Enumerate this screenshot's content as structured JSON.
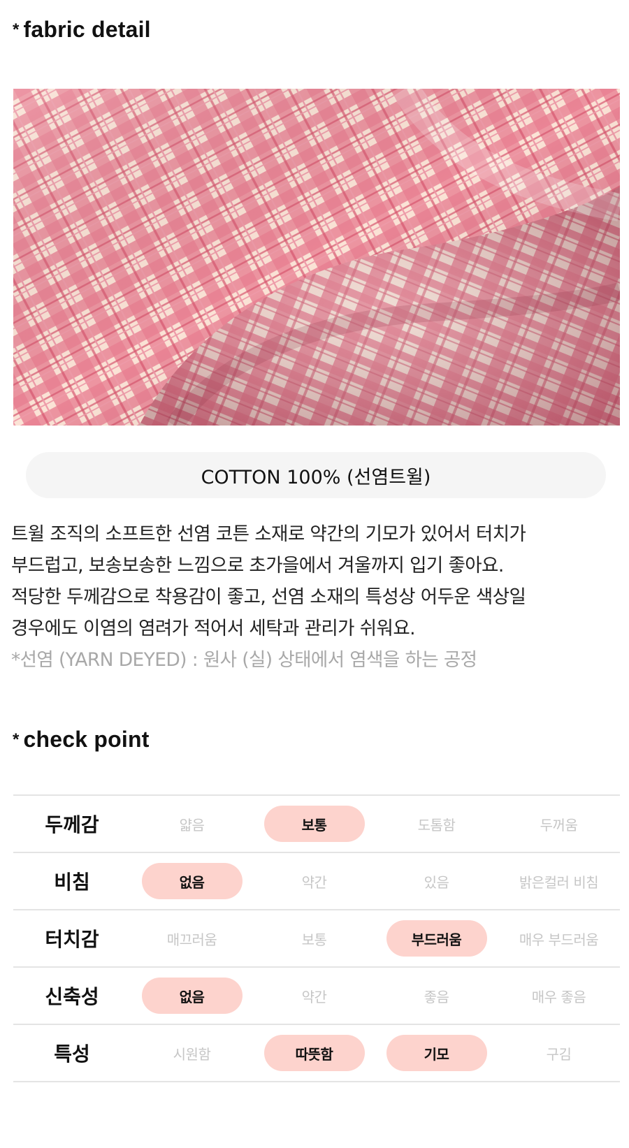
{
  "fabric_detail": {
    "star": "*",
    "title": "fabric detail",
    "material": "COTTON 100% (선염트윌)",
    "description_lines": [
      "트윌 조직의 소프트한 선염 코튼 소재로 약간의 기모가 있어서 터치가",
      "부드럽고, 보송보송한 느낌으로 초가을에서 겨울까지 입기 좋아요.",
      "적당한 두께감으로 착용감이 좋고, 선염 소재의 특성상 어두운 색상일",
      "경우에도 이염의 염려가 적어서 세탁과 관리가 쉬워요."
    ],
    "note": "*선염 (YARN DEYED) : 원사 (실) 상태에서 염색을 하는 공정",
    "photo_icon": "pink-plaid-fabric-photo",
    "colors": {
      "plaid_pink": "#e88d9c",
      "plaid_cream": "#fbe3d6"
    }
  },
  "check_point": {
    "star": "*",
    "title": "check point",
    "highlight_color": "#fdd3cd",
    "rows": [
      {
        "label": "두께감",
        "options": [
          {
            "text": "얇음",
            "selected": false
          },
          {
            "text": "보통",
            "selected": true
          },
          {
            "text": "도톰함",
            "selected": false
          },
          {
            "text": "두꺼움",
            "selected": false
          }
        ]
      },
      {
        "label": "비침",
        "options": [
          {
            "text": "없음",
            "selected": true
          },
          {
            "text": "약간",
            "selected": false
          },
          {
            "text": "있음",
            "selected": false
          },
          {
            "text": "밝은컬러 비침",
            "selected": false
          }
        ]
      },
      {
        "label": "터치감",
        "options": [
          {
            "text": "매끄러움",
            "selected": false
          },
          {
            "text": "보통",
            "selected": false
          },
          {
            "text": "부드러움",
            "selected": true
          },
          {
            "text": "매우 부드러움",
            "selected": false
          }
        ]
      },
      {
        "label": "신축성",
        "options": [
          {
            "text": "없음",
            "selected": true
          },
          {
            "text": "약간",
            "selected": false
          },
          {
            "text": "좋음",
            "selected": false
          },
          {
            "text": "매우 좋음",
            "selected": false
          }
        ]
      },
      {
        "label": "특성",
        "options": [
          {
            "text": "시원함",
            "selected": false
          },
          {
            "text": "따뜻함",
            "selected": true
          },
          {
            "text": "기모",
            "selected": true
          },
          {
            "text": "구김",
            "selected": false
          }
        ]
      }
    ]
  }
}
